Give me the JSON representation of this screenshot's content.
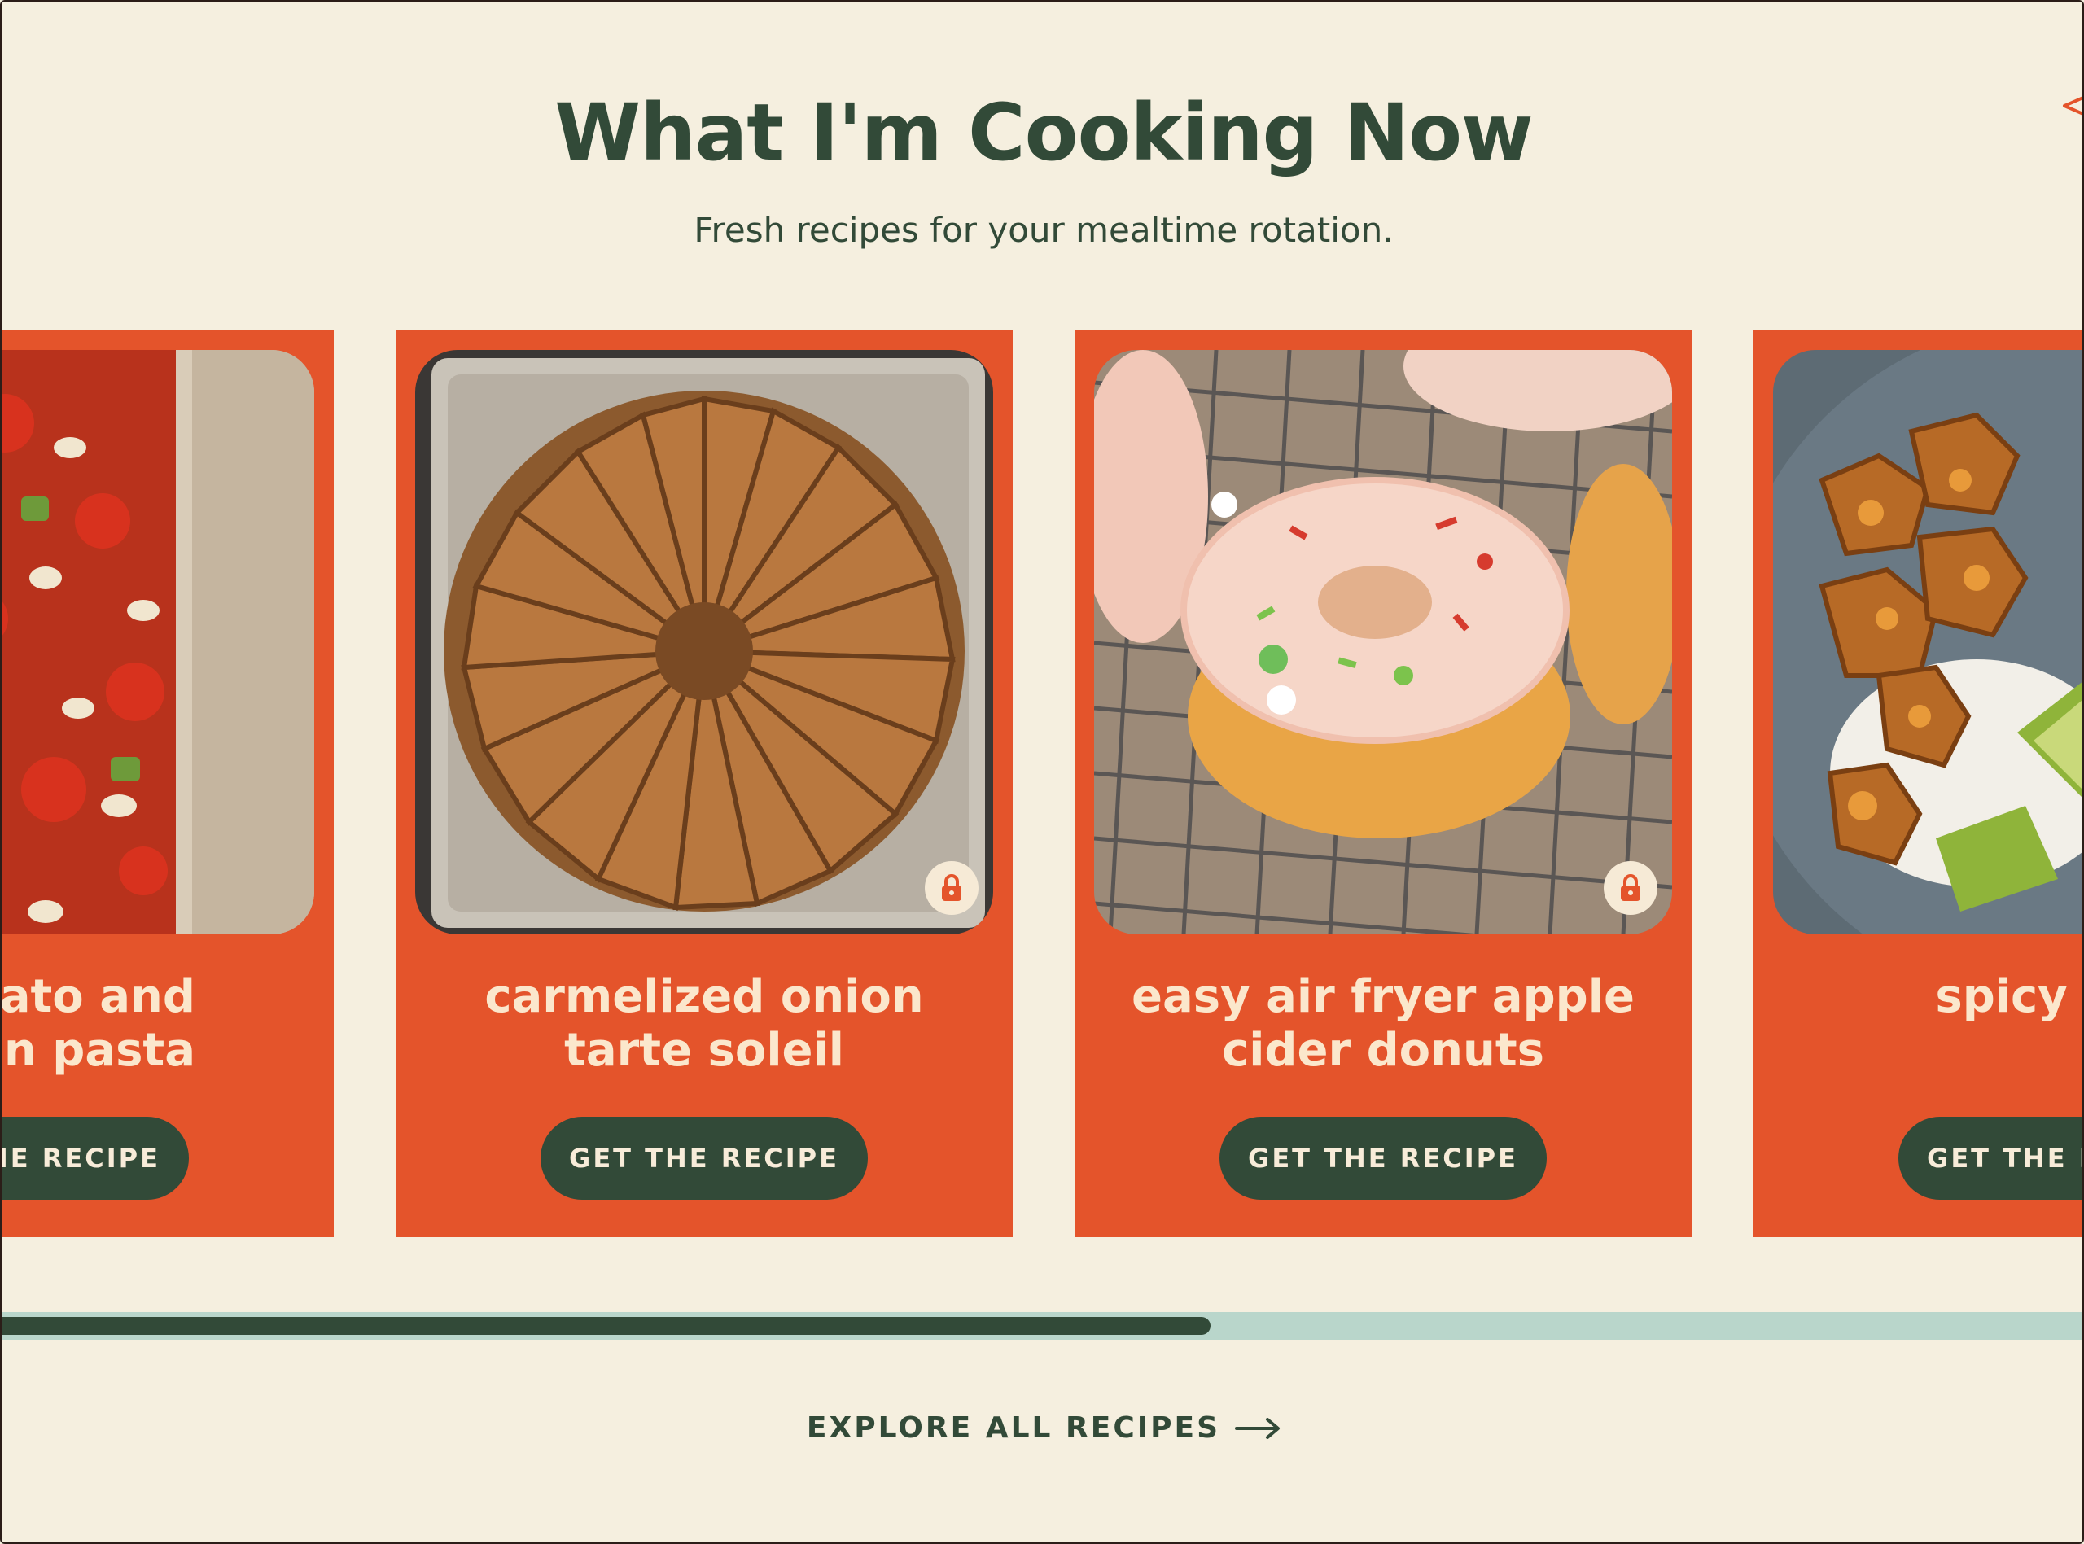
{
  "section": {
    "title": "What I'm Cooking Now",
    "subtitle": "Fresh recipes for your mealtime rotation."
  },
  "cards": [
    {
      "name": "tomato and white bean pasta",
      "name_visible_line1": "omato and",
      "name_visible_line2": "ean pasta",
      "button": "GET THE RECIPE",
      "locked": false
    },
    {
      "name_line1": "carmelized onion",
      "name_line2": "tarte soleil",
      "button": "GET THE RECIPE",
      "locked": true
    },
    {
      "name_line1": "easy air fryer apple",
      "name_line2": "cider donuts",
      "button": "GET THE RECIPE",
      "locked": true
    },
    {
      "name_line1": "spicy tofu",
      "name_line2": "",
      "button": "GET THE RECIPE",
      "locked": false
    }
  ],
  "carousel": {
    "progress": 0.58
  },
  "explore": {
    "label": "EXPLORE ALL RECIPES",
    "icon": "arrow-right-icon"
  },
  "colors": {
    "background": "#f5efdf",
    "card": "#e4542b",
    "dark_green": "#324a38",
    "card_text": "#fbe7cc",
    "progress_track": "#b9d6cb"
  }
}
